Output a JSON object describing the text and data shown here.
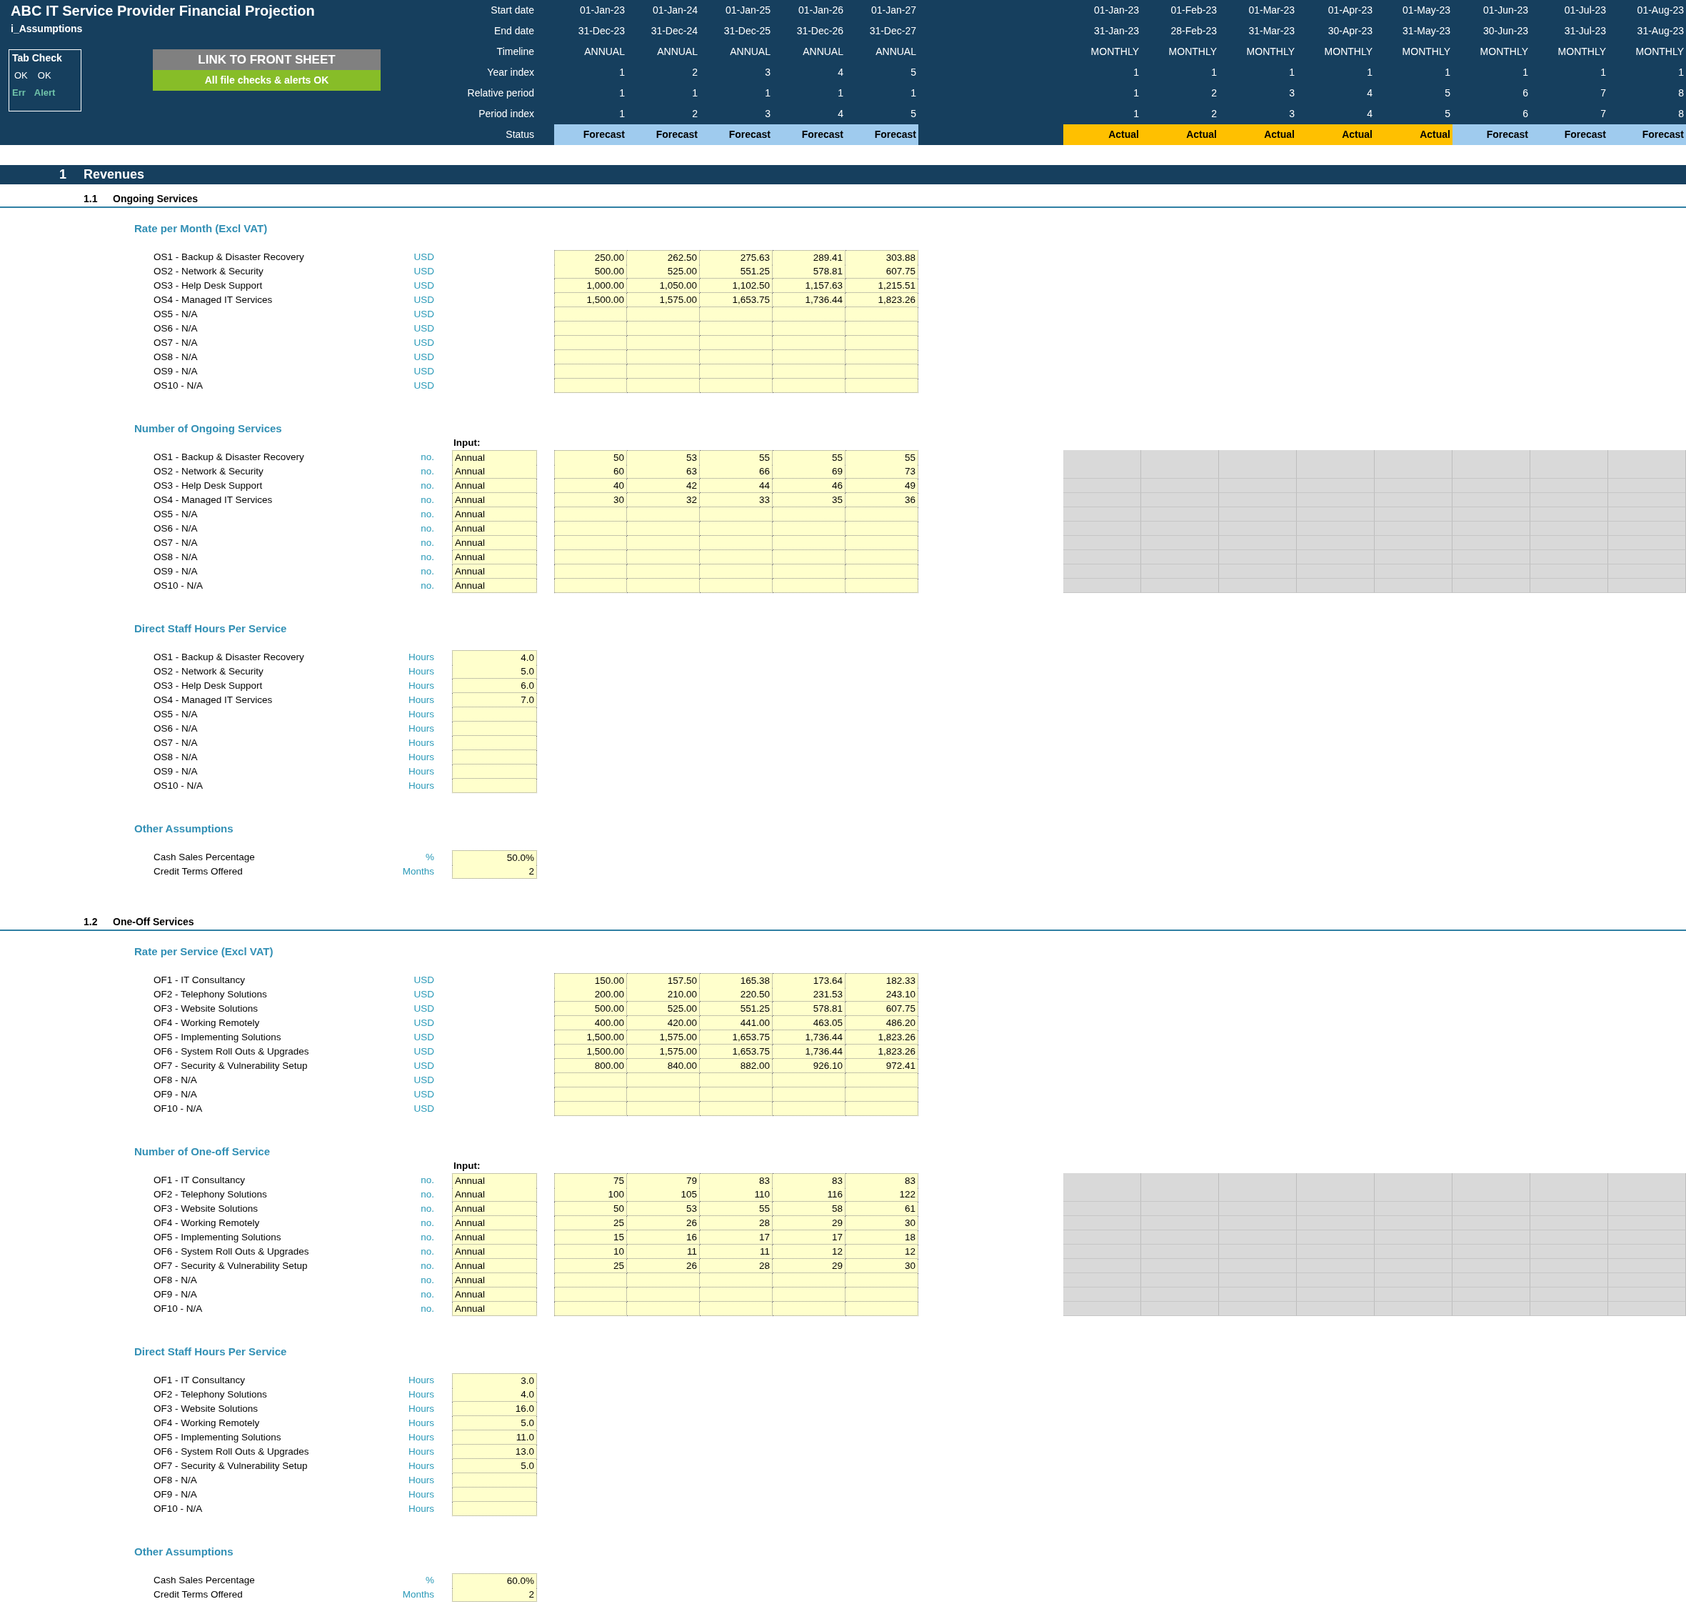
{
  "header": {
    "title": "ABC IT Service Provider Financial Projection",
    "sheet": "i_Assumptions",
    "tab_check": {
      "title": "Tab Check",
      "values": [
        "OK",
        "OK"
      ],
      "legend": [
        "Err",
        "Alert"
      ]
    },
    "link_button": "LINK TO FRONT SHEET",
    "check_status": "All file checks & alerts OK",
    "timeline_rows": [
      {
        "label": "Start date",
        "annual": [
          "01-Jan-23",
          "01-Jan-24",
          "01-Jan-25",
          "01-Jan-26",
          "01-Jan-27"
        ],
        "monthly": [
          "01-Jan-23",
          "01-Feb-23",
          "01-Mar-23",
          "01-Apr-23",
          "01-May-23",
          "01-Jun-23",
          "01-Jul-23",
          "01-Aug-23"
        ]
      },
      {
        "label": "End date",
        "annual": [
          "31-Dec-23",
          "31-Dec-24",
          "31-Dec-25",
          "31-Dec-26",
          "31-Dec-27"
        ],
        "monthly": [
          "31-Jan-23",
          "28-Feb-23",
          "31-Mar-23",
          "30-Apr-23",
          "31-May-23",
          "30-Jun-23",
          "31-Jul-23",
          "31-Aug-23"
        ]
      },
      {
        "label": "Timeline",
        "annual": [
          "ANNUAL",
          "ANNUAL",
          "ANNUAL",
          "ANNUAL",
          "ANNUAL"
        ],
        "monthly": [
          "MONTHLY",
          "MONTHLY",
          "MONTHLY",
          "MONTHLY",
          "MONTHLY",
          "MONTHLY",
          "MONTHLY",
          "MONTHLY"
        ]
      },
      {
        "label": "Year index",
        "annual": [
          "1",
          "2",
          "3",
          "4",
          "5"
        ],
        "monthly": [
          "1",
          "1",
          "1",
          "1",
          "1",
          "1",
          "1",
          "1"
        ]
      },
      {
        "label": "Relative period",
        "annual": [
          "1",
          "1",
          "1",
          "1",
          "1"
        ],
        "monthly": [
          "1",
          "2",
          "3",
          "4",
          "5",
          "6",
          "7",
          "8"
        ]
      },
      {
        "label": "Period index",
        "annual": [
          "1",
          "2",
          "3",
          "4",
          "5"
        ],
        "monthly": [
          "1",
          "2",
          "3",
          "4",
          "5",
          "6",
          "7",
          "8"
        ]
      }
    ],
    "status": {
      "label": "Status",
      "annual": [
        {
          "label": "Forecast",
          "kind": "forecast"
        },
        {
          "label": "Forecast",
          "kind": "forecast"
        },
        {
          "label": "Forecast",
          "kind": "forecast"
        },
        {
          "label": "Forecast",
          "kind": "forecast"
        },
        {
          "label": "Forecast",
          "kind": "forecast"
        }
      ],
      "monthly": [
        {
          "label": "Actual",
          "kind": "actual"
        },
        {
          "label": "Actual",
          "kind": "actual"
        },
        {
          "label": "Actual",
          "kind": "actual"
        },
        {
          "label": "Actual",
          "kind": "actual"
        },
        {
          "label": "Actual",
          "kind": "actual"
        },
        {
          "label": "Forecast",
          "kind": "forecast"
        },
        {
          "label": "Forecast",
          "kind": "forecast"
        },
        {
          "label": "Forecast",
          "kind": "forecast"
        }
      ]
    }
  },
  "section": {
    "number": "1",
    "title": "Revenues",
    "subsections": [
      {
        "number": "1.1",
        "title": "Ongoing Services",
        "blocks": [
          {
            "kind": "rates",
            "title": "Rate per Month (Excl VAT)",
            "rows": [
              {
                "label": "OS1 - Backup & Disaster Recovery",
                "unit": "USD",
                "values": [
                  "250.00",
                  "262.50",
                  "275.63",
                  "289.41",
                  "303.88"
                ]
              },
              {
                "label": "OS2 - Network & Security",
                "unit": "USD",
                "values": [
                  "500.00",
                  "525.00",
                  "551.25",
                  "578.81",
                  "607.75"
                ]
              },
              {
                "label": "OS3 - Help Desk Support",
                "unit": "USD",
                "values": [
                  "1,000.00",
                  "1,050.00",
                  "1,102.50",
                  "1,157.63",
                  "1,215.51"
                ]
              },
              {
                "label": "OS4 - Managed IT Services",
                "unit": "USD",
                "values": [
                  "1,500.00",
                  "1,575.00",
                  "1,653.75",
                  "1,736.44",
                  "1,823.26"
                ]
              },
              {
                "label": "OS5 - N/A",
                "unit": "USD"
              },
              {
                "label": "OS6 - N/A",
                "unit": "USD"
              },
              {
                "label": "OS7 - N/A",
                "unit": "USD"
              },
              {
                "label": "OS8 - N/A",
                "unit": "USD"
              },
              {
                "label": "OS9 - N/A",
                "unit": "USD"
              },
              {
                "label": "OS10 - N/A",
                "unit": "USD"
              }
            ]
          },
          {
            "kind": "counts",
            "title": "Number of Ongoing Services",
            "input_heading": "Input:",
            "rows": [
              {
                "label": "OS1 - Backup & Disaster Recovery",
                "unit": "no.",
                "input": "Annual",
                "values": [
                  "50",
                  "53",
                  "55",
                  "55",
                  "55"
                ]
              },
              {
                "label": "OS2 - Network & Security",
                "unit": "no.",
                "input": "Annual",
                "values": [
                  "60",
                  "63",
                  "66",
                  "69",
                  "73"
                ]
              },
              {
                "label": "OS3 - Help Desk Support",
                "unit": "no.",
                "input": "Annual",
                "values": [
                  "40",
                  "42",
                  "44",
                  "46",
                  "49"
                ]
              },
              {
                "label": "OS4 - Managed IT Services",
                "unit": "no.",
                "input": "Annual",
                "values": [
                  "30",
                  "32",
                  "33",
                  "35",
                  "36"
                ]
              },
              {
                "label": "OS5 - N/A",
                "unit": "no.",
                "input": "Annual"
              },
              {
                "label": "OS6 - N/A",
                "unit": "no.",
                "input": "Annual"
              },
              {
                "label": "OS7 - N/A",
                "unit": "no.",
                "input": "Annual"
              },
              {
                "label": "OS8 - N/A",
                "unit": "no.",
                "input": "Annual"
              },
              {
                "label": "OS9 - N/A",
                "unit": "no.",
                "input": "Annual"
              },
              {
                "label": "OS10 - N/A",
                "unit": "no.",
                "input": "Annual"
              }
            ]
          },
          {
            "kind": "hours",
            "title": "Direct Staff Hours Per Service",
            "rows": [
              {
                "label": "OS1 - Backup & Disaster Recovery",
                "unit": "Hours",
                "value": "4.0"
              },
              {
                "label": "OS2 - Network & Security",
                "unit": "Hours",
                "value": "5.0"
              },
              {
                "label": "OS3 - Help Desk Support",
                "unit": "Hours",
                "value": "6.0"
              },
              {
                "label": "OS4 - Managed IT Services",
                "unit": "Hours",
                "value": "7.0"
              },
              {
                "label": "OS5 - N/A",
                "unit": "Hours"
              },
              {
                "label": "OS6 - N/A",
                "unit": "Hours"
              },
              {
                "label": "OS7 - N/A",
                "unit": "Hours"
              },
              {
                "label": "OS8 - N/A",
                "unit": "Hours"
              },
              {
                "label": "OS9 - N/A",
                "unit": "Hours"
              },
              {
                "label": "OS10 - N/A",
                "unit": "Hours"
              }
            ]
          },
          {
            "kind": "hours",
            "title": "Other Assumptions",
            "rows": [
              {
                "label": "Cash Sales Percentage",
                "unit": "%",
                "value": "50.0%"
              },
              {
                "label": "Credit Terms Offered",
                "unit": "Months",
                "value": "2"
              }
            ]
          }
        ]
      },
      {
        "number": "1.2",
        "title": "One-Off Services",
        "blocks": [
          {
            "kind": "rates",
            "title": "Rate per Service (Excl VAT)",
            "rows": [
              {
                "label": "OF1 - IT Consultancy",
                "unit": "USD",
                "values": [
                  "150.00",
                  "157.50",
                  "165.38",
                  "173.64",
                  "182.33"
                ]
              },
              {
                "label": "OF2 - Telephony Solutions",
                "unit": "USD",
                "values": [
                  "200.00",
                  "210.00",
                  "220.50",
                  "231.53",
                  "243.10"
                ]
              },
              {
                "label": "OF3 - Website Solutions",
                "unit": "USD",
                "values": [
                  "500.00",
                  "525.00",
                  "551.25",
                  "578.81",
                  "607.75"
                ]
              },
              {
                "label": "OF4 - Working Remotely",
                "unit": "USD",
                "values": [
                  "400.00",
                  "420.00",
                  "441.00",
                  "463.05",
                  "486.20"
                ]
              },
              {
                "label": "OF5 - Implementing Solutions",
                "unit": "USD",
                "values": [
                  "1,500.00",
                  "1,575.00",
                  "1,653.75",
                  "1,736.44",
                  "1,823.26"
                ]
              },
              {
                "label": "OF6 - System Roll Outs & Upgrades",
                "unit": "USD",
                "values": [
                  "1,500.00",
                  "1,575.00",
                  "1,653.75",
                  "1,736.44",
                  "1,823.26"
                ]
              },
              {
                "label": "OF7 - Security & Vulnerability Setup",
                "unit": "USD",
                "values": [
                  "800.00",
                  "840.00",
                  "882.00",
                  "926.10",
                  "972.41"
                ]
              },
              {
                "label": "OF8 - N/A",
                "unit": "USD"
              },
              {
                "label": "OF9 - N/A",
                "unit": "USD"
              },
              {
                "label": "OF10 - N/A",
                "unit": "USD"
              }
            ]
          },
          {
            "kind": "counts",
            "title": "Number of One-off Service",
            "input_heading": "Input:",
            "rows": [
              {
                "label": "OF1 - IT Consultancy",
                "unit": "no.",
                "input": "Annual",
                "values": [
                  "75",
                  "79",
                  "83",
                  "83",
                  "83"
                ]
              },
              {
                "label": "OF2 - Telephony Solutions",
                "unit": "no.",
                "input": "Annual",
                "values": [
                  "100",
                  "105",
                  "110",
                  "116",
                  "122"
                ]
              },
              {
                "label": "OF3 - Website Solutions",
                "unit": "no.",
                "input": "Annual",
                "values": [
                  "50",
                  "53",
                  "55",
                  "58",
                  "61"
                ]
              },
              {
                "label": "OF4 - Working Remotely",
                "unit": "no.",
                "input": "Annual",
                "values": [
                  "25",
                  "26",
                  "28",
                  "29",
                  "30"
                ]
              },
              {
                "label": "OF5 - Implementing Solutions",
                "unit": "no.",
                "input": "Annual",
                "values": [
                  "15",
                  "16",
                  "17",
                  "17",
                  "18"
                ]
              },
              {
                "label": "OF6 - System Roll Outs & Upgrades",
                "unit": "no.",
                "input": "Annual",
                "values": [
                  "10",
                  "11",
                  "11",
                  "12",
                  "12"
                ]
              },
              {
                "label": "OF7 - Security & Vulnerability Setup",
                "unit": "no.",
                "input": "Annual",
                "values": [
                  "25",
                  "26",
                  "28",
                  "29",
                  "30"
                ]
              },
              {
                "label": "OF8 - N/A",
                "unit": "no.",
                "input": "Annual"
              },
              {
                "label": "OF9 - N/A",
                "unit": "no.",
                "input": "Annual"
              },
              {
                "label": "OF10 - N/A",
                "unit": "no.",
                "input": "Annual"
              }
            ]
          },
          {
            "kind": "hours",
            "title": "Direct Staff Hours Per Service",
            "rows": [
              {
                "label": "OF1 - IT Consultancy",
                "unit": "Hours",
                "value": "3.0"
              },
              {
                "label": "OF2 - Telephony Solutions",
                "unit": "Hours",
                "value": "4.0"
              },
              {
                "label": "OF3 - Website Solutions",
                "unit": "Hours",
                "value": "16.0"
              },
              {
                "label": "OF4 - Working Remotely",
                "unit": "Hours",
                "value": "5.0"
              },
              {
                "label": "OF5 - Implementing Solutions",
                "unit": "Hours",
                "value": "11.0"
              },
              {
                "label": "OF6 - System Roll Outs & Upgrades",
                "unit": "Hours",
                "value": "13.0"
              },
              {
                "label": "OF7 - Security & Vulnerability Setup",
                "unit": "Hours",
                "value": "5.0"
              },
              {
                "label": "OF8 - N/A",
                "unit": "Hours"
              },
              {
                "label": "OF9 - N/A",
                "unit": "Hours"
              },
              {
                "label": "OF10 - N/A",
                "unit": "Hours"
              }
            ]
          },
          {
            "kind": "hours",
            "title": "Other Assumptions",
            "rows": [
              {
                "label": "Cash Sales Percentage",
                "unit": "%",
                "value": "60.0%"
              },
              {
                "label": "Credit Terms Offered",
                "unit": "Months",
                "value": "2"
              }
            ]
          }
        ]
      }
    ]
  }
}
